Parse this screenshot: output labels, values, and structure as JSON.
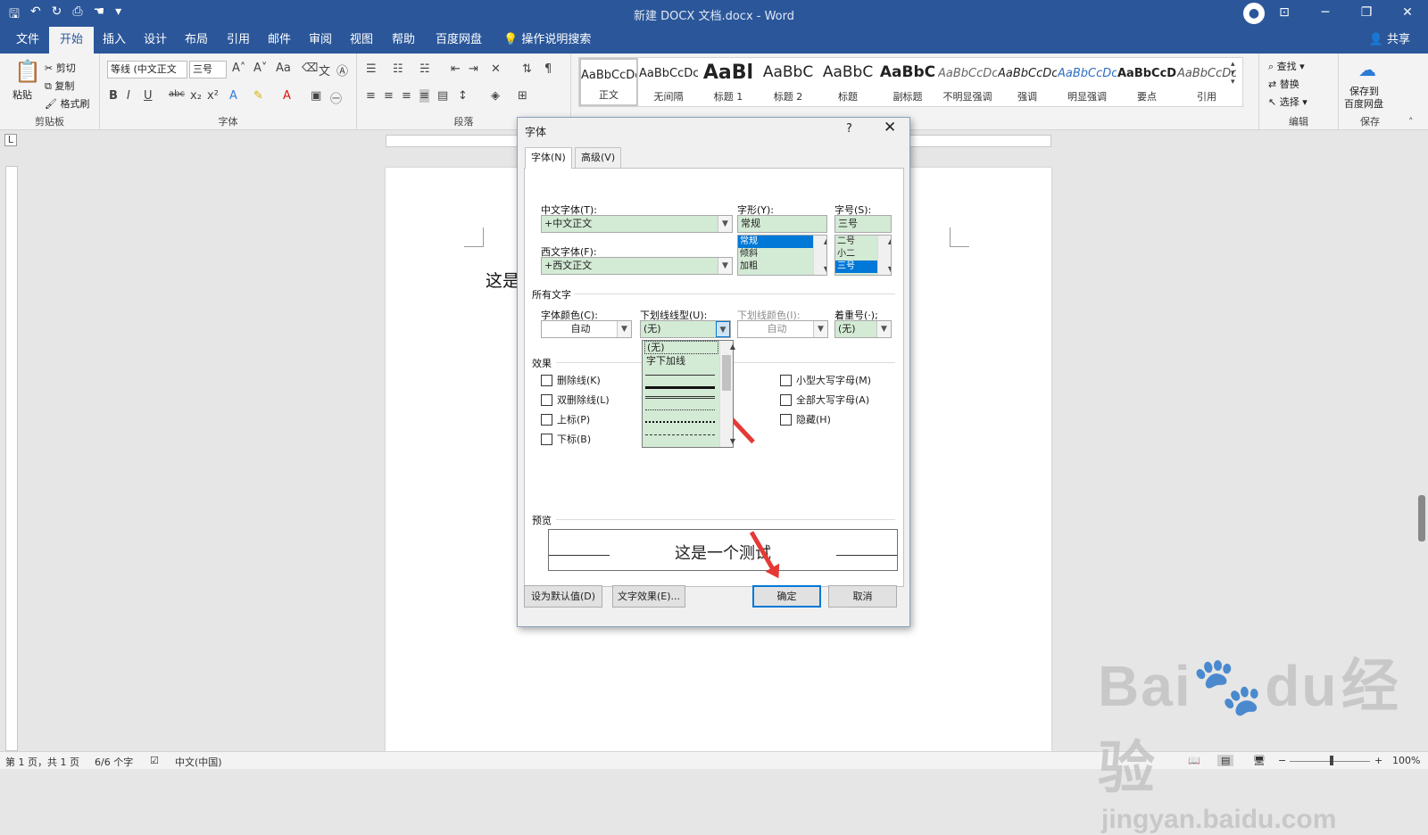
{
  "window": {
    "title": "新建 DOCX 文档.docx - Word"
  },
  "menu": {
    "tabs": [
      "文件",
      "开始",
      "插入",
      "设计",
      "布局",
      "引用",
      "邮件",
      "审阅",
      "视图",
      "帮助",
      "百度网盘"
    ],
    "tell_me": "操作说明搜索",
    "share": "共享"
  },
  "ribbon": {
    "clipboard": {
      "label": "剪贴板",
      "paste": "粘贴",
      "cut": "剪切",
      "copy": "复制",
      "format_painter": "格式刷"
    },
    "font": {
      "label": "字体",
      "font_name": "等线 (中文正文",
      "font_size": "三号"
    },
    "paragraph": {
      "label": "段落"
    },
    "styles": {
      "items": [
        {
          "preview": "AaBbCcDc",
          "name": "正文"
        },
        {
          "preview": "AaBbCcDc",
          "name": "无间隔"
        },
        {
          "preview": "AaBl",
          "name": "标题 1"
        },
        {
          "preview": "AaBbC",
          "name": "标题 2"
        },
        {
          "preview": "AaBbC",
          "name": "标题"
        },
        {
          "preview": "AaBbC",
          "name": "副标题"
        },
        {
          "preview": "AaBbCcDc",
          "name": "不明显强调"
        },
        {
          "preview": "AaBbCcDc",
          "name": "强调"
        },
        {
          "preview": "AaBbCcDc",
          "name": "明显强调"
        },
        {
          "preview": "AaBbCcD",
          "name": "要点"
        },
        {
          "preview": "AaBbCcDc",
          "name": "引用"
        }
      ]
    },
    "editing": {
      "label": "编辑",
      "find": "查找",
      "replace": "替换",
      "select": "选择"
    },
    "save": {
      "label": "保存",
      "save_to": "保存到",
      "baidu": "百度网盘"
    }
  },
  "document": {
    "text": "这是"
  },
  "dialog": {
    "title": "字体",
    "help": "?",
    "tab_font": "字体(N)",
    "tab_advanced": "高级(V)",
    "cn_font_label": "中文字体(T):",
    "cn_font_value": "+中文正文",
    "west_font_label": "西文字体(F):",
    "west_font_value": "+西文正文",
    "style_label": "字形(Y):",
    "style_value": "常规",
    "style_list": [
      "常规",
      "倾斜",
      "加粗"
    ],
    "size_label": "字号(S):",
    "size_value": "三号",
    "size_list": [
      "二号",
      "小二",
      "三号"
    ],
    "all_text": "所有文字",
    "color_label": "字体颜色(C):",
    "color_value": "自动",
    "underline_label": "下划线线型(U):",
    "underline_value": "(无)",
    "underline_options": [
      "(无)",
      "字下加线"
    ],
    "ucolor_label": "下划线颜色(I):",
    "ucolor_value": "自动",
    "emph_label": "着重号(·);",
    "emph_value": "(无)",
    "effects": "效果",
    "checks_left": [
      "删除线(K)",
      "双删除线(L)",
      "上标(P)",
      "下标(B)"
    ],
    "checks_right": [
      "小型大写字母(M)",
      "全部大写字母(A)",
      "隐藏(H)"
    ],
    "preview_label": "预览",
    "preview_text": "这是一个测试",
    "btn_default": "设为默认值(D)",
    "btn_effects": "文字效果(E)...",
    "btn_ok": "确定",
    "btn_cancel": "取消"
  },
  "status": {
    "page": "第 1 页，共 1 页",
    "words": "6/6 个字",
    "lang": "中文(中国)",
    "zoom": "100%"
  },
  "watermark": {
    "brand": "Bai",
    "brand2": "du",
    "cn": "经验",
    "url": "jingyan.baidu.com"
  },
  "colors": {
    "title_bar": "#2b579a",
    "field_bg": "#d3ead5",
    "selection": "#0078d7",
    "arrow": "#e53935"
  }
}
